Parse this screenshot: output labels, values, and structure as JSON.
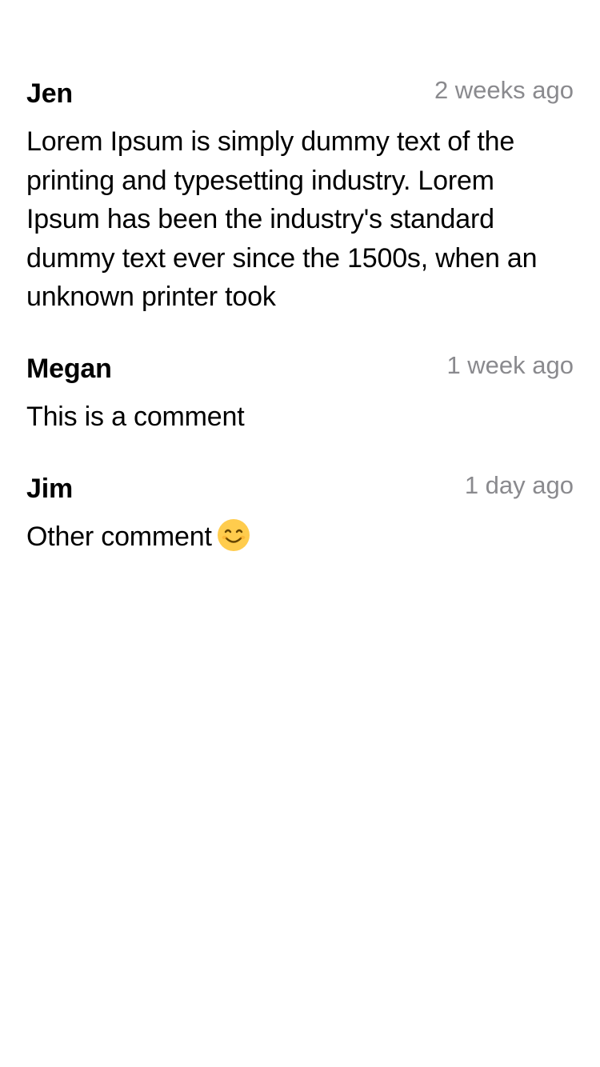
{
  "comments": [
    {
      "author": "Jen",
      "time": "2 weeks ago",
      "text": "Lorem Ipsum is simply dummy text of the printing and typesetting industry. Lorem Ipsum has been the industry's standard dummy text ever since the 1500s, when an unknown printer took"
    },
    {
      "author": "Megan",
      "time": "1 week ago",
      "text": "This is a comment"
    },
    {
      "author": "Jim",
      "time": "1 day ago",
      "text": "Other comment"
    }
  ],
  "icons": {
    "comment_3_trailing": "smiling-face-icon"
  },
  "colors": {
    "text": "#000000",
    "timestamp": "#8a8a8e",
    "background": "#ffffff",
    "emoji_face": "#ffcc4d",
    "emoji_features": "#664500"
  }
}
